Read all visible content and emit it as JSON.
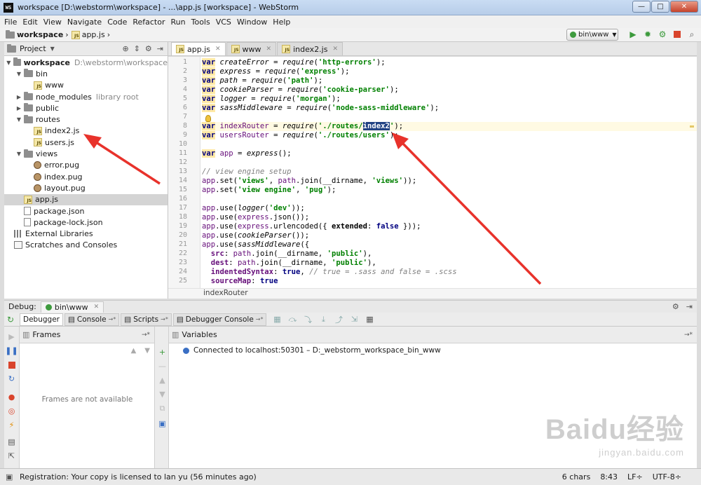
{
  "window": {
    "title": "workspace [D:\\webstorm\\workspace] - ...\\app.js [workspace] - WebStorm",
    "logo_text": "WS",
    "buttons": [
      "—",
      "□",
      "✕"
    ]
  },
  "menu": [
    "File",
    "Edit",
    "View",
    "Navigate",
    "Code",
    "Refactor",
    "Run",
    "Tools",
    "VCS",
    "Window",
    "Help"
  ],
  "navbar": {
    "crumbs": [
      {
        "label": "workspace",
        "icon": "folder-icon"
      },
      {
        "label": "app.js",
        "icon": "js-file-icon"
      }
    ],
    "run_config": "bin\\www",
    "tools": [
      "run-icon",
      "debug-icon",
      "coverage-icon",
      "stop-icon",
      "search-icon"
    ]
  },
  "project": {
    "header": "Project",
    "tree": [
      {
        "label": "workspace",
        "extra": "D:\\webstorm\\workspace",
        "depth": 0,
        "expanded": true,
        "icon": "folder-icon",
        "bold": true
      },
      {
        "label": "bin",
        "depth": 1,
        "expanded": true,
        "icon": "folder-icon"
      },
      {
        "label": "www",
        "depth": 2,
        "icon": "js-file-icon"
      },
      {
        "label": "node_modules",
        "extra": "library root",
        "depth": 1,
        "expanded": false,
        "icon": "folder-icon"
      },
      {
        "label": "public",
        "depth": 1,
        "expanded": false,
        "icon": "folder-icon"
      },
      {
        "label": "routes",
        "depth": 1,
        "expanded": true,
        "icon": "folder-icon"
      },
      {
        "label": "index2.js",
        "depth": 2,
        "icon": "js-file-icon"
      },
      {
        "label": "users.js",
        "depth": 2,
        "icon": "js-file-icon"
      },
      {
        "label": "views",
        "depth": 1,
        "expanded": true,
        "icon": "folder-icon"
      },
      {
        "label": "error.pug",
        "depth": 2,
        "icon": "pug-file-icon"
      },
      {
        "label": "index.pug",
        "depth": 2,
        "icon": "pug-file-icon"
      },
      {
        "label": "layout.pug",
        "depth": 2,
        "icon": "pug-file-icon"
      },
      {
        "label": "app.js",
        "depth": 1,
        "icon": "js-file-icon",
        "selected": true
      },
      {
        "label": "package.json",
        "depth": 1,
        "icon": "json-file-icon"
      },
      {
        "label": "package-lock.json",
        "depth": 1,
        "icon": "json-file-icon"
      },
      {
        "label": "External Libraries",
        "depth": 0,
        "icon": "libraries-icon"
      },
      {
        "label": "Scratches and Consoles",
        "depth": 0,
        "icon": "scratches-icon"
      }
    ]
  },
  "editor": {
    "tabs": [
      {
        "label": "app.js",
        "active": true
      },
      {
        "label": "www",
        "active": false
      },
      {
        "label": "index2.js",
        "active": false
      }
    ],
    "line_numbers": [
      "1",
      "2",
      "3",
      "4",
      "5",
      "6",
      "7",
      "8",
      "9",
      "10",
      "11",
      "12",
      "13",
      "14",
      "15",
      "16",
      "17",
      "18",
      "19",
      "20",
      "21",
      "22",
      "23",
      "24",
      "25"
    ],
    "breadcrumb": "indexRouter"
  },
  "debug": {
    "label": "Debug:",
    "config": "bin\\www",
    "tabs": [
      "Debugger",
      "Console",
      "Scripts",
      "Debugger Console"
    ],
    "frames_title": "Frames",
    "frames_empty": "Frames are not available",
    "variables_title": "Variables",
    "message": "Connected to localhost:50301 – D:_webstorm_workspace_bin_www"
  },
  "status": {
    "message": "Registration: Your copy is licensed to lan yu (56 minutes ago)",
    "chars": "6 chars",
    "position": "8:43",
    "line_sep": "LF÷",
    "encoding": "UTF-8÷"
  },
  "watermark": {
    "text": "Baidu经验",
    "url": "jingyan.baidu.com"
  },
  "colors": {
    "keyword": "#000080",
    "string": "#008000",
    "selection": "#214283",
    "annotation_arrow": "#e8322b"
  }
}
